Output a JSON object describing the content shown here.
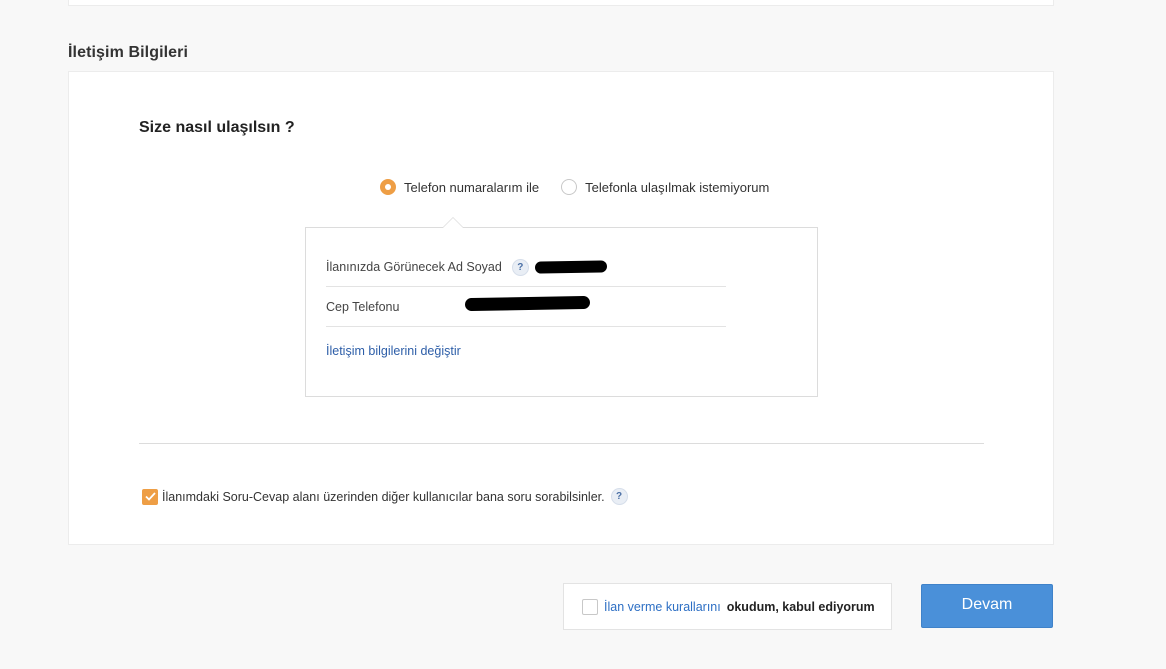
{
  "section": {
    "title": "İletişim Bilgileri"
  },
  "contact": {
    "question": "Size nasıl ulaşılsın ?",
    "options": [
      {
        "label": "Telefon numaralarım ile",
        "selected": true
      },
      {
        "label": "Telefonla ulaşılmak istemiyorum",
        "selected": false
      }
    ],
    "name_label": "İlanınızda Görünecek Ad Soyad",
    "phone_label": "Cep Telefonu",
    "help_symbol": "?",
    "change_link": "İletişim bilgilerini değiştir"
  },
  "qa": {
    "label": "İlanımdaki Soru-Cevap alanı üzerinden diğer kullanıcılar bana soru sorabilsinler.",
    "checked": true,
    "help_symbol": "?"
  },
  "rules": {
    "link": "İlan verme kurallarını",
    "text": "okudum, kabul ediyorum",
    "checked": false
  },
  "actions": {
    "continue_label": "Devam"
  },
  "colors": {
    "accent": "#ee9e45",
    "link": "#2d5ea8",
    "button": "#4a90d9"
  }
}
